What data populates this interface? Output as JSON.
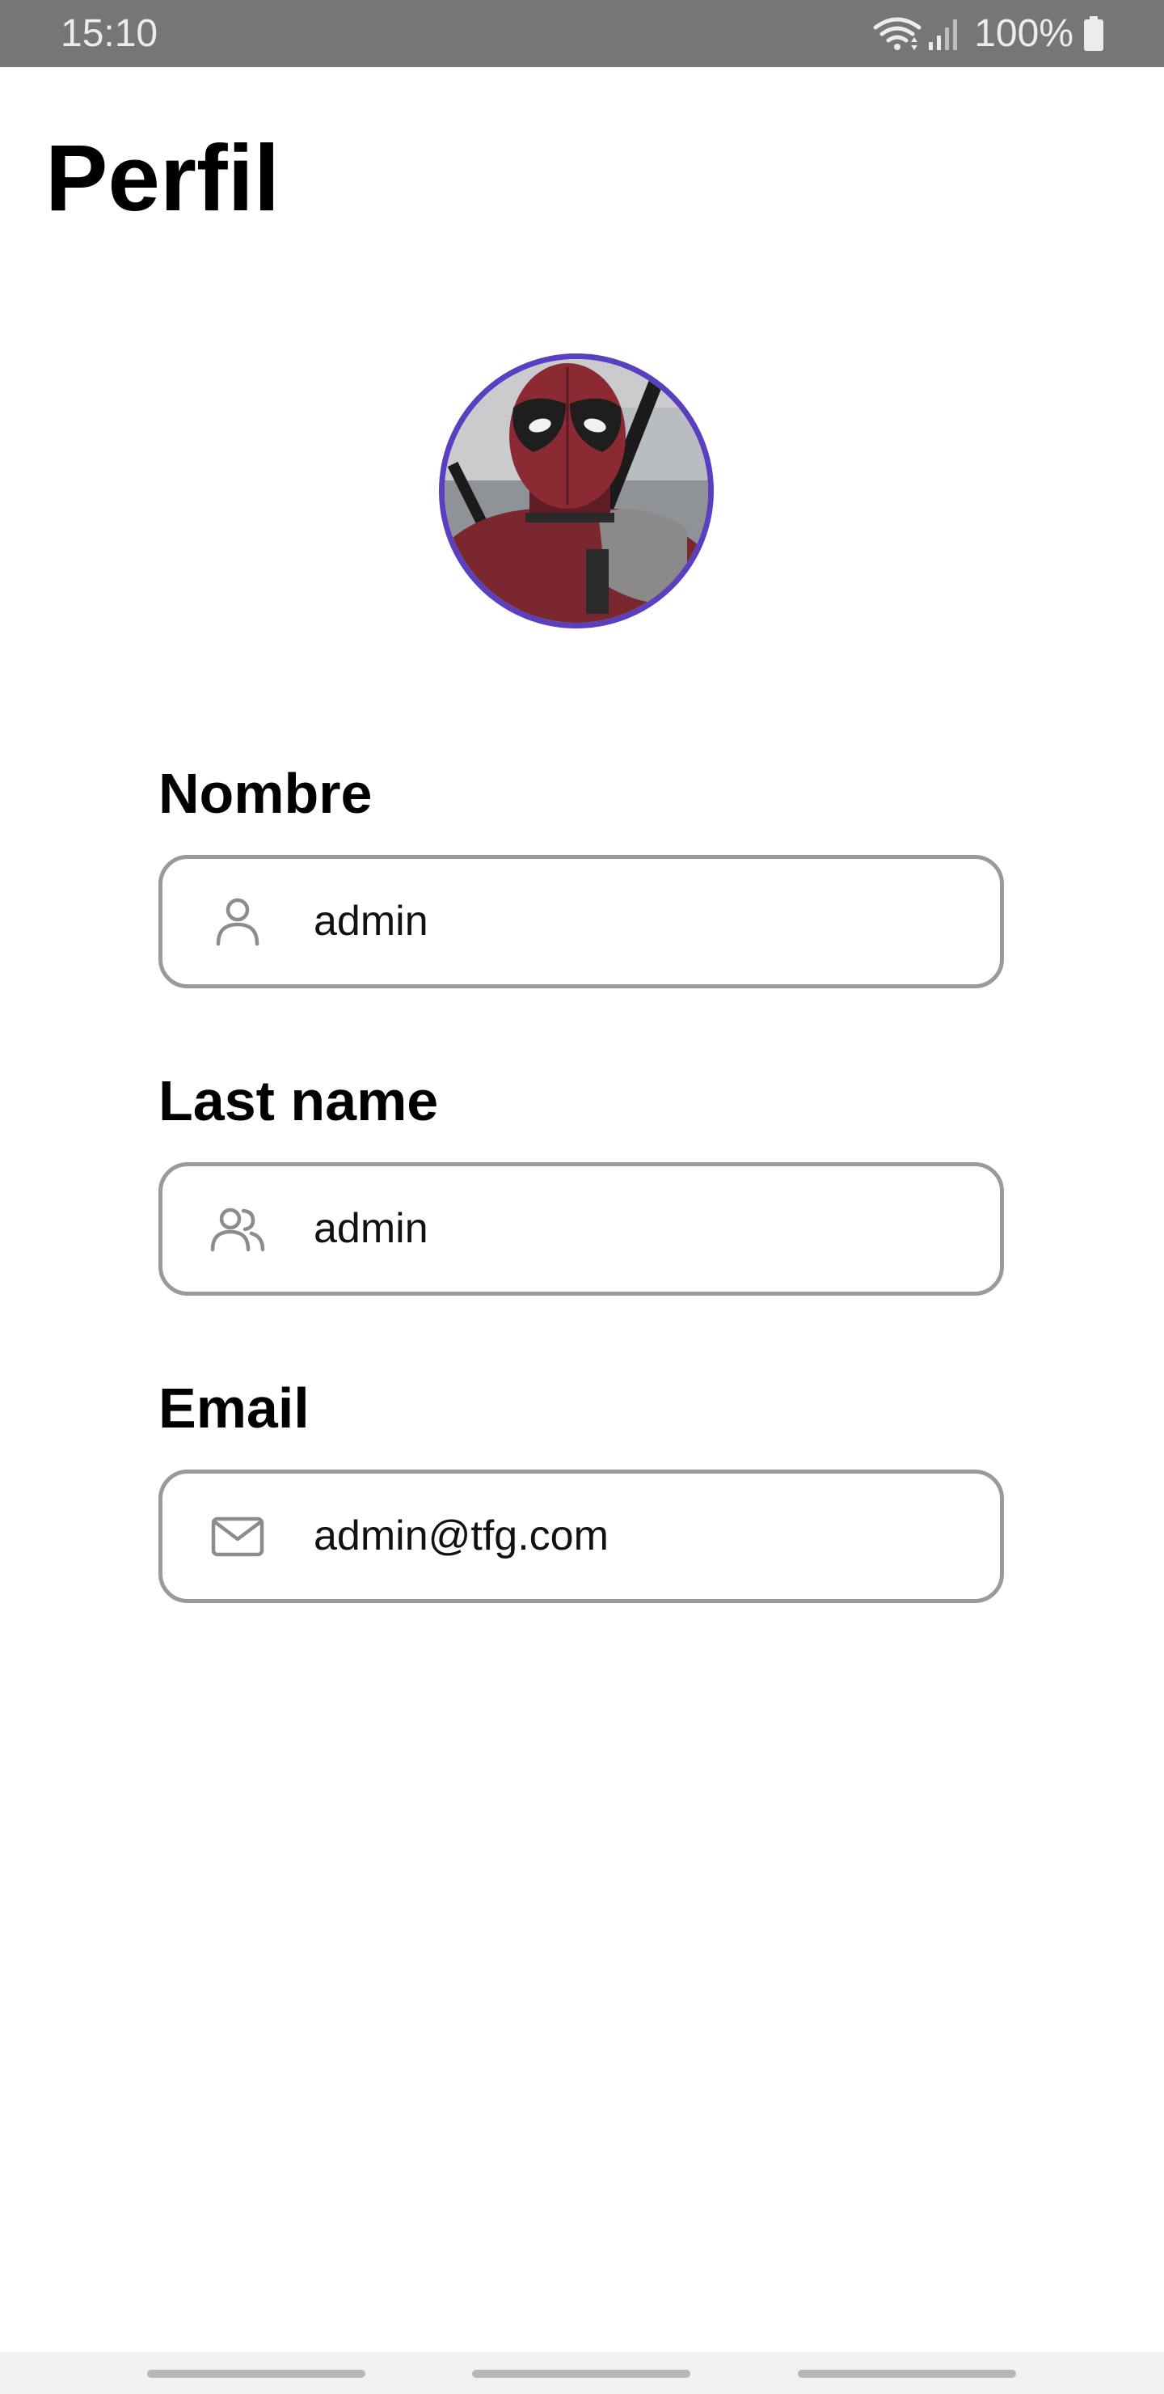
{
  "status_bar": {
    "time": "15:10",
    "battery_text": "100%",
    "icons": [
      "wifi-icon",
      "signal-icon",
      "battery-icon"
    ]
  },
  "page": {
    "title": "Perfil"
  },
  "avatar": {
    "description_icon": "profile-avatar",
    "border_color": "#5a3fc0"
  },
  "fields": {
    "first_name": {
      "label": "Nombre",
      "value": "admin",
      "icon": "person-icon"
    },
    "last_name": {
      "label": "Last name",
      "value": "admin",
      "icon": "people-icon"
    },
    "email": {
      "label": "Email",
      "value": "admin@tfg.com",
      "icon": "mail-icon"
    }
  },
  "colors": {
    "status_bar_bg": "#767676",
    "field_border": "#9a9a9a",
    "icon_gray": "#8c8c8c"
  }
}
